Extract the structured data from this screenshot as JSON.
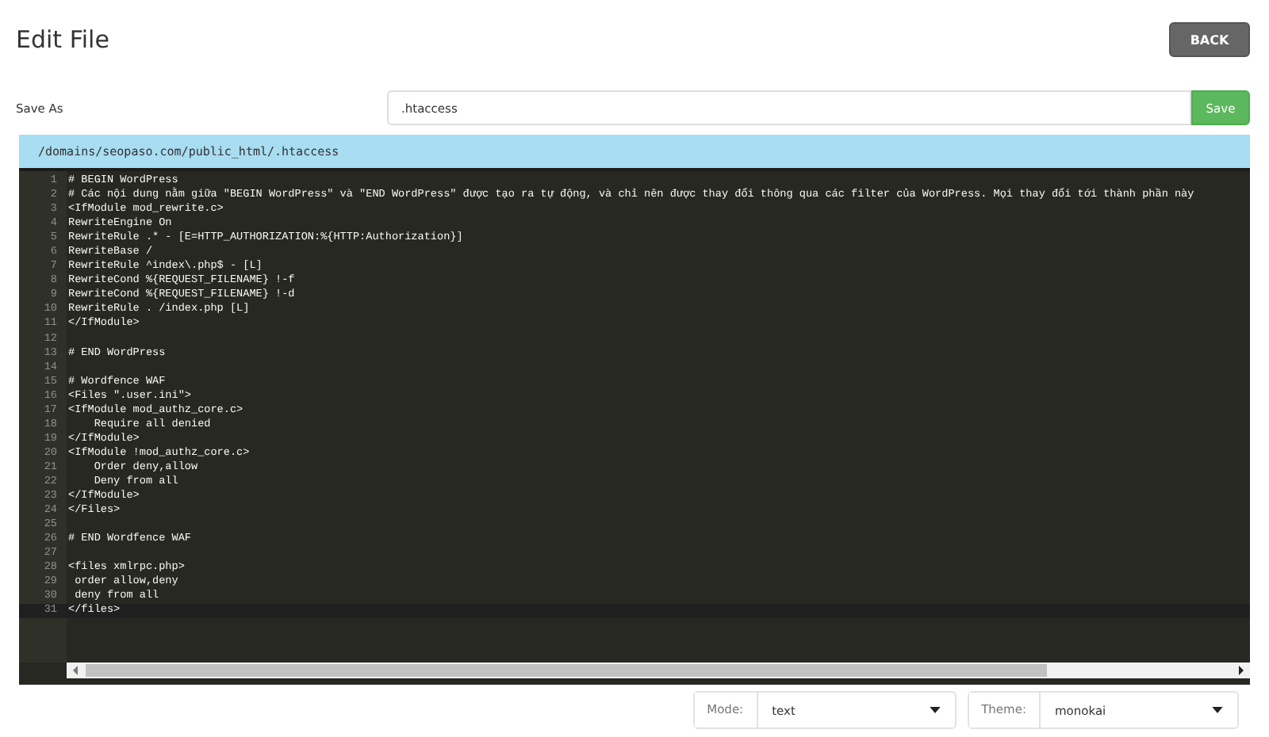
{
  "page_title": "Edit File",
  "back_button": "BACK",
  "save_as": {
    "label": "Save As",
    "value": ".htaccess",
    "button": "Save"
  },
  "file_path": "/domains/seopaso.com/public_html/.htaccess",
  "editor": {
    "lines": [
      {
        "number": "1",
        "text": "# BEGIN WordPress",
        "active": false
      },
      {
        "number": "2",
        "text": "# Các nội dung nằm giữa \"BEGIN WordPress\" và \"END WordPress\" được tạo ra tự động, và chỉ nên được thay đổi thông qua các filter của WordPress. Mọi thay đổi tới thành phần này",
        "active": false
      },
      {
        "number": "3",
        "text": "<IfModule mod_rewrite.c>",
        "active": false
      },
      {
        "number": "4",
        "text": "RewriteEngine On",
        "active": false
      },
      {
        "number": "5",
        "text": "RewriteRule .* - [E=HTTP_AUTHORIZATION:%{HTTP:Authorization}]",
        "active": false
      },
      {
        "number": "6",
        "text": "RewriteBase /",
        "active": false
      },
      {
        "number": "7",
        "text": "RewriteRule ^index\\.php$ - [L]",
        "active": false
      },
      {
        "number": "8",
        "text": "RewriteCond %{REQUEST_FILENAME} !-f",
        "active": false
      },
      {
        "number": "9",
        "text": "RewriteCond %{REQUEST_FILENAME} !-d",
        "active": false
      },
      {
        "number": "10",
        "text": "RewriteRule . /index.php [L]",
        "active": false
      },
      {
        "number": "11",
        "text": "</IfModule>",
        "active": false
      },
      {
        "number": "12",
        "active": false
      },
      {
        "number": "13",
        "text": "# END WordPress",
        "active": false
      },
      {
        "number": "14",
        "active": false
      },
      {
        "number": "15",
        "text": "# Wordfence WAF",
        "active": false
      },
      {
        "number": "16",
        "text": "<Files \".user.ini\">",
        "active": false
      },
      {
        "number": "17",
        "text": "<IfModule mod_authz_core.c>",
        "active": false
      },
      {
        "number": "18",
        "text": "    Require all denied",
        "active": false
      },
      {
        "number": "19",
        "text": "</IfModule>",
        "active": false
      },
      {
        "number": "20",
        "text": "<IfModule !mod_authz_core.c>",
        "active": false
      },
      {
        "number": "21",
        "text": "    Order deny,allow",
        "active": false
      },
      {
        "number": "22",
        "text": "    Deny from all",
        "active": false
      },
      {
        "number": "23",
        "text": "</IfModule>",
        "active": false
      },
      {
        "number": "24",
        "text": "</Files>",
        "active": false
      },
      {
        "number": "25",
        "active": false
      },
      {
        "number": "26",
        "text": "# END Wordfence WAF",
        "active": false
      },
      {
        "number": "27",
        "active": false
      },
      {
        "number": "28",
        "text": "<files xmlrpc.php>",
        "active": false
      },
      {
        "number": "29",
        "text": " order allow,deny",
        "active": false
      },
      {
        "number": "30",
        "text": " deny from all",
        "active": false
      },
      {
        "number": "31",
        "text": "</files>",
        "active": true
      }
    ]
  },
  "mode": {
    "label": "Mode:",
    "value": "text"
  },
  "theme": {
    "label": "Theme:",
    "value": "monokai"
  }
}
